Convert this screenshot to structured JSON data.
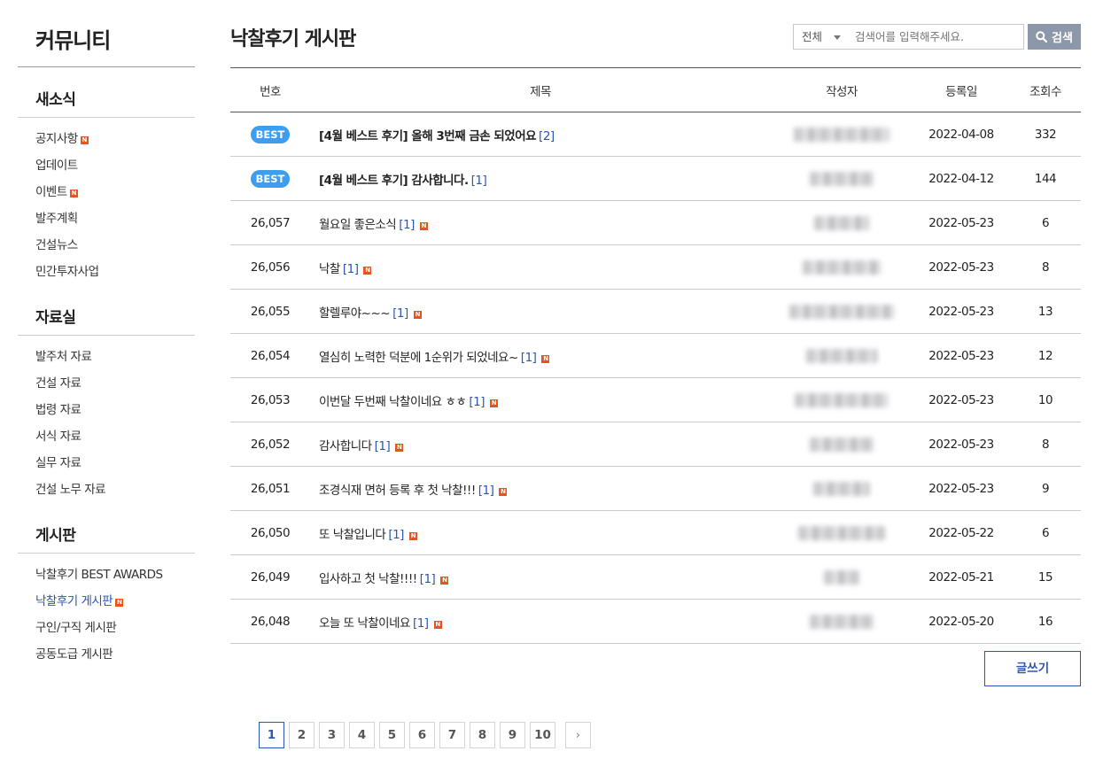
{
  "sidebar": {
    "title": "커뮤니티",
    "sections": [
      {
        "title": "새소식",
        "items": [
          {
            "label": "공지사항",
            "new": true
          },
          {
            "label": "업데이트",
            "new": false
          },
          {
            "label": "이벤트",
            "new": true
          },
          {
            "label": "발주계획",
            "new": false
          },
          {
            "label": "건설뉴스",
            "new": false
          },
          {
            "label": "민간투자사업",
            "new": false
          }
        ]
      },
      {
        "title": "자료실",
        "items": [
          {
            "label": "발주처 자료",
            "new": false
          },
          {
            "label": "건설 자료",
            "new": false
          },
          {
            "label": "법령 자료",
            "new": false
          },
          {
            "label": "서식 자료",
            "new": false
          },
          {
            "label": "실무 자료",
            "new": false
          },
          {
            "label": "건설 노무 자료",
            "new": false
          }
        ]
      },
      {
        "title": "게시판",
        "items": [
          {
            "label": "낙찰후기 BEST AWARDS",
            "new": false
          },
          {
            "label": "낙찰후기 게시판",
            "new": true,
            "active": true
          },
          {
            "label": "구인/구직 게시판",
            "new": false
          },
          {
            "label": "공동도급 게시판",
            "new": false
          }
        ]
      }
    ],
    "new_badge": "N"
  },
  "page_title": "낙찰후기 게시판",
  "search": {
    "scope": "전체",
    "placeholder": "검색어를 입력해주세요.",
    "button_label": "검색"
  },
  "table": {
    "headers": {
      "no": "번호",
      "title": "제목",
      "author": "작성자",
      "date": "등록일",
      "views": "조회수"
    },
    "best_label": "BEST",
    "rows": [
      {
        "no": "BEST",
        "best": true,
        "title": "[4월 베스트 후기] 올해 3번째 금손 되었어요",
        "comments": "[2]",
        "new": false,
        "date": "2022-04-08",
        "views": "332"
      },
      {
        "no": "BEST",
        "best": true,
        "title": "[4월 베스트 후기] 감사합니다.",
        "comments": "[1]",
        "new": false,
        "date": "2022-04-12",
        "views": "144"
      },
      {
        "no": "26,057",
        "best": false,
        "title": "월요일 좋은소식",
        "comments": "[1]",
        "new": true,
        "date": "2022-05-23",
        "views": "6"
      },
      {
        "no": "26,056",
        "best": false,
        "title": "낙찰",
        "comments": "[1]",
        "new": true,
        "date": "2022-05-23",
        "views": "8"
      },
      {
        "no": "26,055",
        "best": false,
        "title": "할렐루야~~~",
        "comments": "[1]",
        "new": true,
        "date": "2022-05-23",
        "views": "13"
      },
      {
        "no": "26,054",
        "best": false,
        "title": "열심히 노력한 덕분에 1순위가 되었네요~",
        "comments": "[1]",
        "new": true,
        "date": "2022-05-23",
        "views": "12"
      },
      {
        "no": "26,053",
        "best": false,
        "title": "이번달 두번째 낙찰이네요 ㅎㅎ",
        "comments": "[1]",
        "new": true,
        "date": "2022-05-23",
        "views": "10"
      },
      {
        "no": "26,052",
        "best": false,
        "title": "감사합니다",
        "comments": "[1]",
        "new": true,
        "date": "2022-05-23",
        "views": "8"
      },
      {
        "no": "26,051",
        "best": false,
        "title": "조경식재 면허 등록 후 첫 낙찰!!!",
        "comments": "[1]",
        "new": true,
        "date": "2022-05-23",
        "views": "9"
      },
      {
        "no": "26,050",
        "best": false,
        "title": "또 낙찰입니다",
        "comments": "[1]",
        "new": true,
        "date": "2022-05-22",
        "views": "6"
      },
      {
        "no": "26,049",
        "best": false,
        "title": "입사하고 첫 낙찰!!!!",
        "comments": "[1]",
        "new": true,
        "date": "2022-05-21",
        "views": "15"
      },
      {
        "no": "26,048",
        "best": false,
        "title": "오늘 또 낙찰이네요",
        "comments": "[1]",
        "new": true,
        "date": "2022-05-20",
        "views": "16"
      }
    ]
  },
  "write_button": "글쓰기",
  "pagination": {
    "pages": [
      "1",
      "2",
      "3",
      "4",
      "5",
      "6",
      "7",
      "8",
      "9",
      "10"
    ],
    "current": "1",
    "next": "›"
  },
  "colors": {
    "accent": "#2c55b8",
    "best": "#3d9ef0",
    "new": "#e8541f",
    "search_button": "#8d97aa"
  }
}
